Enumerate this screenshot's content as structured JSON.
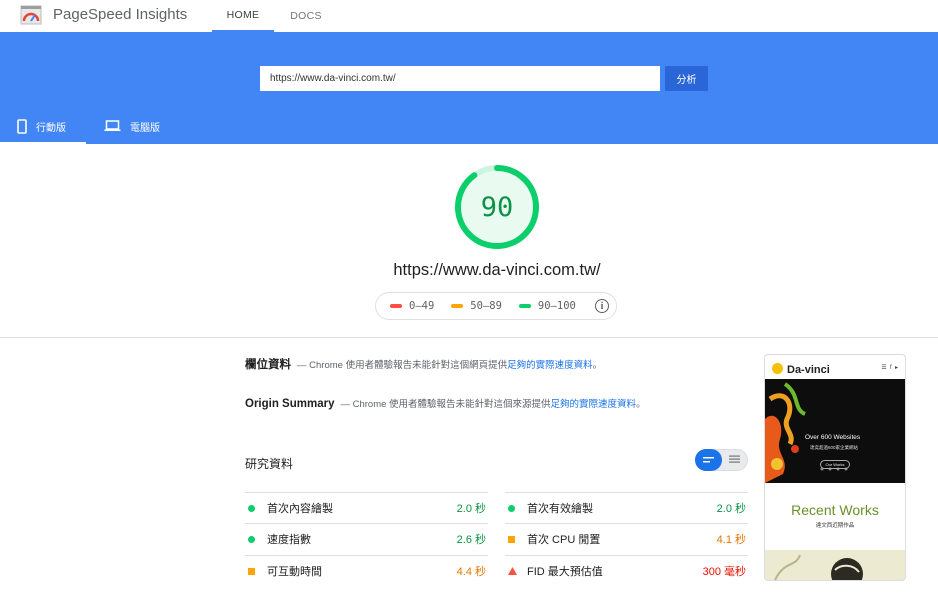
{
  "header": {
    "app_title": "PageSpeed Insights",
    "nav": [
      {
        "label": "HOME"
      },
      {
        "label": "DOCS"
      }
    ]
  },
  "search": {
    "url_value": "https://www.da-vinci.com.tw/",
    "analyze_label": "分析"
  },
  "device_tabs": [
    {
      "label": "行動版",
      "icon": "mobile-icon"
    },
    {
      "label": "電腦版",
      "icon": "desktop-icon"
    }
  ],
  "score": {
    "value": "90",
    "fraction": 0.9,
    "url": "https://www.da-vinci.com.tw/"
  },
  "legend": [
    {
      "label": "0–49",
      "color": "#ff4e42"
    },
    {
      "label": "50–89",
      "color": "#ffa400"
    },
    {
      "label": "90–100",
      "color": "#0cce6b"
    }
  ],
  "field_data": {
    "title": "欄位資料",
    "pre": "— Chrome 使用者體驗報告未能針對這個網頁提供",
    "link": "足夠的實際速度資料",
    "post": "。"
  },
  "origin_summary": {
    "title": "Origin Summary",
    "pre": "— Chrome 使用者體驗報告未能針對這個來源提供",
    "link": "足夠的實際速度資料",
    "post": "。"
  },
  "lab": {
    "title": "研究資料",
    "metrics": [
      {
        "label": "首次內容繪製",
        "value": "2.0 秒",
        "status": "pass",
        "color": "#0c9346"
      },
      {
        "label": "首次有效繪製",
        "value": "2.0 秒",
        "status": "pass",
        "color": "#0c9346"
      },
      {
        "label": "速度指數",
        "value": "2.6 秒",
        "status": "pass",
        "color": "#0c9346"
      },
      {
        "label": "首次 CPU 閒置",
        "value": "4.1 秒",
        "status": "average",
        "color": "#e67700"
      },
      {
        "label": "可互動時間",
        "value": "4.4 秒",
        "status": "average",
        "color": "#e67700"
      },
      {
        "label": "FID 最大預估值",
        "value": "300 毫秒",
        "status": "fail",
        "color": "#eb0f00"
      }
    ]
  },
  "thumbnail": {
    "brand": "Da-vinci",
    "hero_title": "Over 600 Websites",
    "hero_sub": "達奕超過600家企業網站",
    "hero_button": "Our Works",
    "section_title": "Recent Works",
    "section_sub": "達文西近期作品"
  }
}
